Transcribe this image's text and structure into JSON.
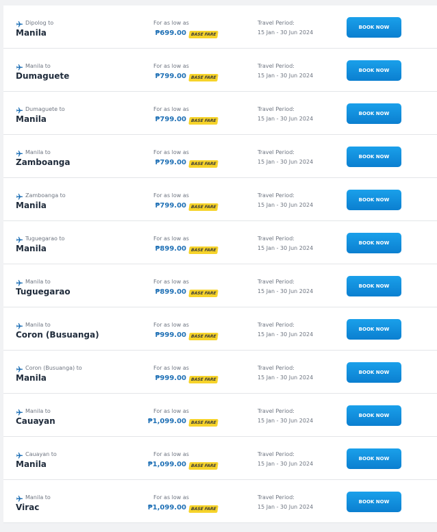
{
  "colors": {
    "price": "#1d6fb5",
    "badge_bg": "#f6d32a",
    "button_bg": "#0b8fe0",
    "title_text": "#1f2b3b",
    "muted_text": "#6d7480"
  },
  "icons": {
    "plane": "airplane-icon"
  },
  "labels": {
    "for_as_low_as": "For as low as",
    "base_fare": "BASE FARE",
    "travel_period_label": "Travel Period:",
    "book_now": "BOOK NOW"
  },
  "fares": [
    {
      "origin": "Dipolog to",
      "destination": "Manila",
      "price": "₱699.00",
      "travel_period": "15 Jan - 30 Jun 2024"
    },
    {
      "origin": "Manila to",
      "destination": "Dumaguete",
      "price": "₱799.00",
      "travel_period": "15 Jan - 30 Jun 2024"
    },
    {
      "origin": "Dumaguete to",
      "destination": "Manila",
      "price": "₱799.00",
      "travel_period": "15 Jan - 30 Jun 2024"
    },
    {
      "origin": "Manila to",
      "destination": "Zamboanga",
      "price": "₱799.00",
      "travel_period": "15 Jan - 30 Jun 2024"
    },
    {
      "origin": "Zamboanga to",
      "destination": "Manila",
      "price": "₱799.00",
      "travel_period": "15 Jan - 30 Jun 2024"
    },
    {
      "origin": "Tuguegarao to",
      "destination": "Manila",
      "price": "₱899.00",
      "travel_period": "15 Jan - 30 Jun 2024"
    },
    {
      "origin": "Manila to",
      "destination": "Tuguegarao",
      "price": "₱899.00",
      "travel_period": "15 Jan - 30 Jun 2024"
    },
    {
      "origin": "Manila to",
      "destination": "Coron (Busuanga)",
      "price": "₱999.00",
      "travel_period": "15 Jan - 30 Jun 2024"
    },
    {
      "origin": "Coron (Busuanga) to",
      "destination": "Manila",
      "price": "₱999.00",
      "travel_period": "15 Jan - 30 Jun 2024"
    },
    {
      "origin": "Manila to",
      "destination": "Cauayan",
      "price": "₱1,099.00",
      "travel_period": "15 Jan - 30 Jun 2024"
    },
    {
      "origin": "Cauayan to",
      "destination": "Manila",
      "price": "₱1,099.00",
      "travel_period": "15 Jan - 30 Jun 2024"
    },
    {
      "origin": "Manila to",
      "destination": "Virac",
      "price": "₱1,099.00",
      "travel_period": "15 Jan - 30 Jun 2024"
    }
  ]
}
